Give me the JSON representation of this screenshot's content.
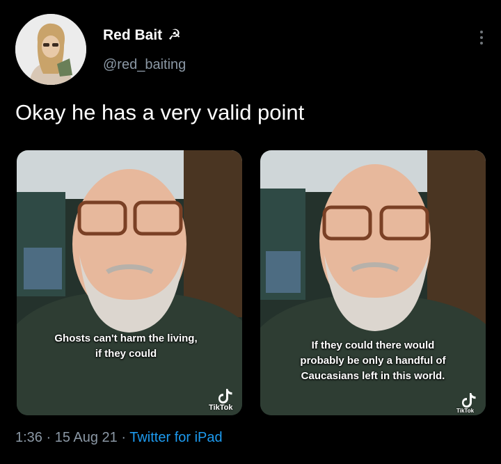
{
  "user": {
    "display_name": "Red Bait",
    "name_emoji": "☭",
    "handle": "@red_baiting"
  },
  "tweet": {
    "text": "Okay he has a very valid point"
  },
  "media": [
    {
      "caption": "Ghosts can't harm the living, if they could",
      "watermark": "TikTok"
    },
    {
      "caption": "If they could there would probably be only a handful of Caucasians left in this world.",
      "watermark": "TikTok"
    }
  ],
  "meta": {
    "time": "1:36",
    "date": "15 Aug 21",
    "source": "Twitter for iPad",
    "separator": " · "
  },
  "icons": {
    "more": "more-options-icon",
    "tiktok": "tiktok-logo-icon"
  },
  "colors": {
    "background": "#000000",
    "secondary_text": "#8b98a5",
    "link": "#1d9bf0"
  }
}
